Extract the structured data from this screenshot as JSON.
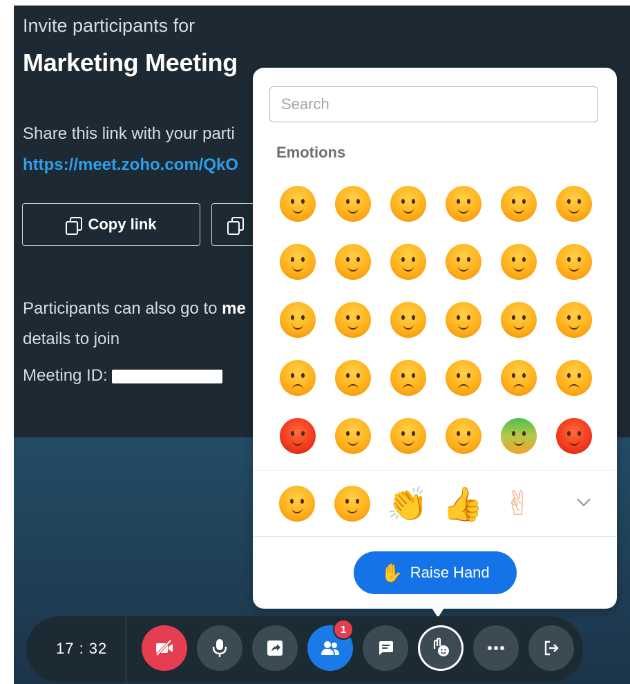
{
  "meeting": {
    "invite_line": "Invite participants for",
    "title": "Marketing Meeting",
    "share_text": "Share this link with your parti",
    "share_link": "https://meet.zoho.com/QkO",
    "copy_link_label": "Copy link",
    "participants_text_a": "Participants can also go to ",
    "participants_text_b": "me",
    "participants_text_c": "details to join",
    "meeting_id_label": "Meeting ID:"
  },
  "emoji_panel": {
    "search_placeholder": "Search",
    "section_label": "Emotions",
    "raise_hand_label": "Raise Hand",
    "emotion_icons": [
      "smiling-face-icon",
      "grinning-face-icon",
      "laughing-tears-icon",
      "big-grin-icon",
      "cool-sunglasses-icon",
      "love-blush-icon",
      "nerd-glasses-icon",
      "surprised-face-icon",
      "thinking-face-icon",
      "magnifier-face-icon",
      "idea-face-icon",
      "cheeky-face-icon",
      "tongue-wink-icon",
      "content-face-icon",
      "peace-wink-icon",
      "blushing-face-icon",
      "yummy-face-icon",
      "angry-tongue-icon",
      "sad-face-icon",
      "disappointed-face-icon",
      "sweat-face-icon",
      "teary-face-icon",
      "worried-face-icon",
      "mad-face-icon",
      "bomb-face-icon",
      "scared-face-icon",
      "skeptical-face-icon",
      "dizzy-face-icon",
      "sick-face-icon",
      "devil-face-icon"
    ],
    "quick_reactions": [
      "laughing-tears-icon",
      "smiling-face-icon",
      "clapping-hands-icon",
      "thumbs-up-icon",
      "victory-hand-icon"
    ]
  },
  "toolbar": {
    "time": "17 : 32",
    "participants_badge": "1",
    "buttons": [
      "video-off-icon",
      "microphone-icon",
      "share-screen-icon",
      "participants-icon",
      "chat-icon",
      "reactions-icon",
      "more-icon",
      "leave-icon"
    ]
  },
  "colors": {
    "primary_blue": "#1473e6",
    "danger_red": "#e53e50",
    "background_dark": "#1d2a33"
  }
}
